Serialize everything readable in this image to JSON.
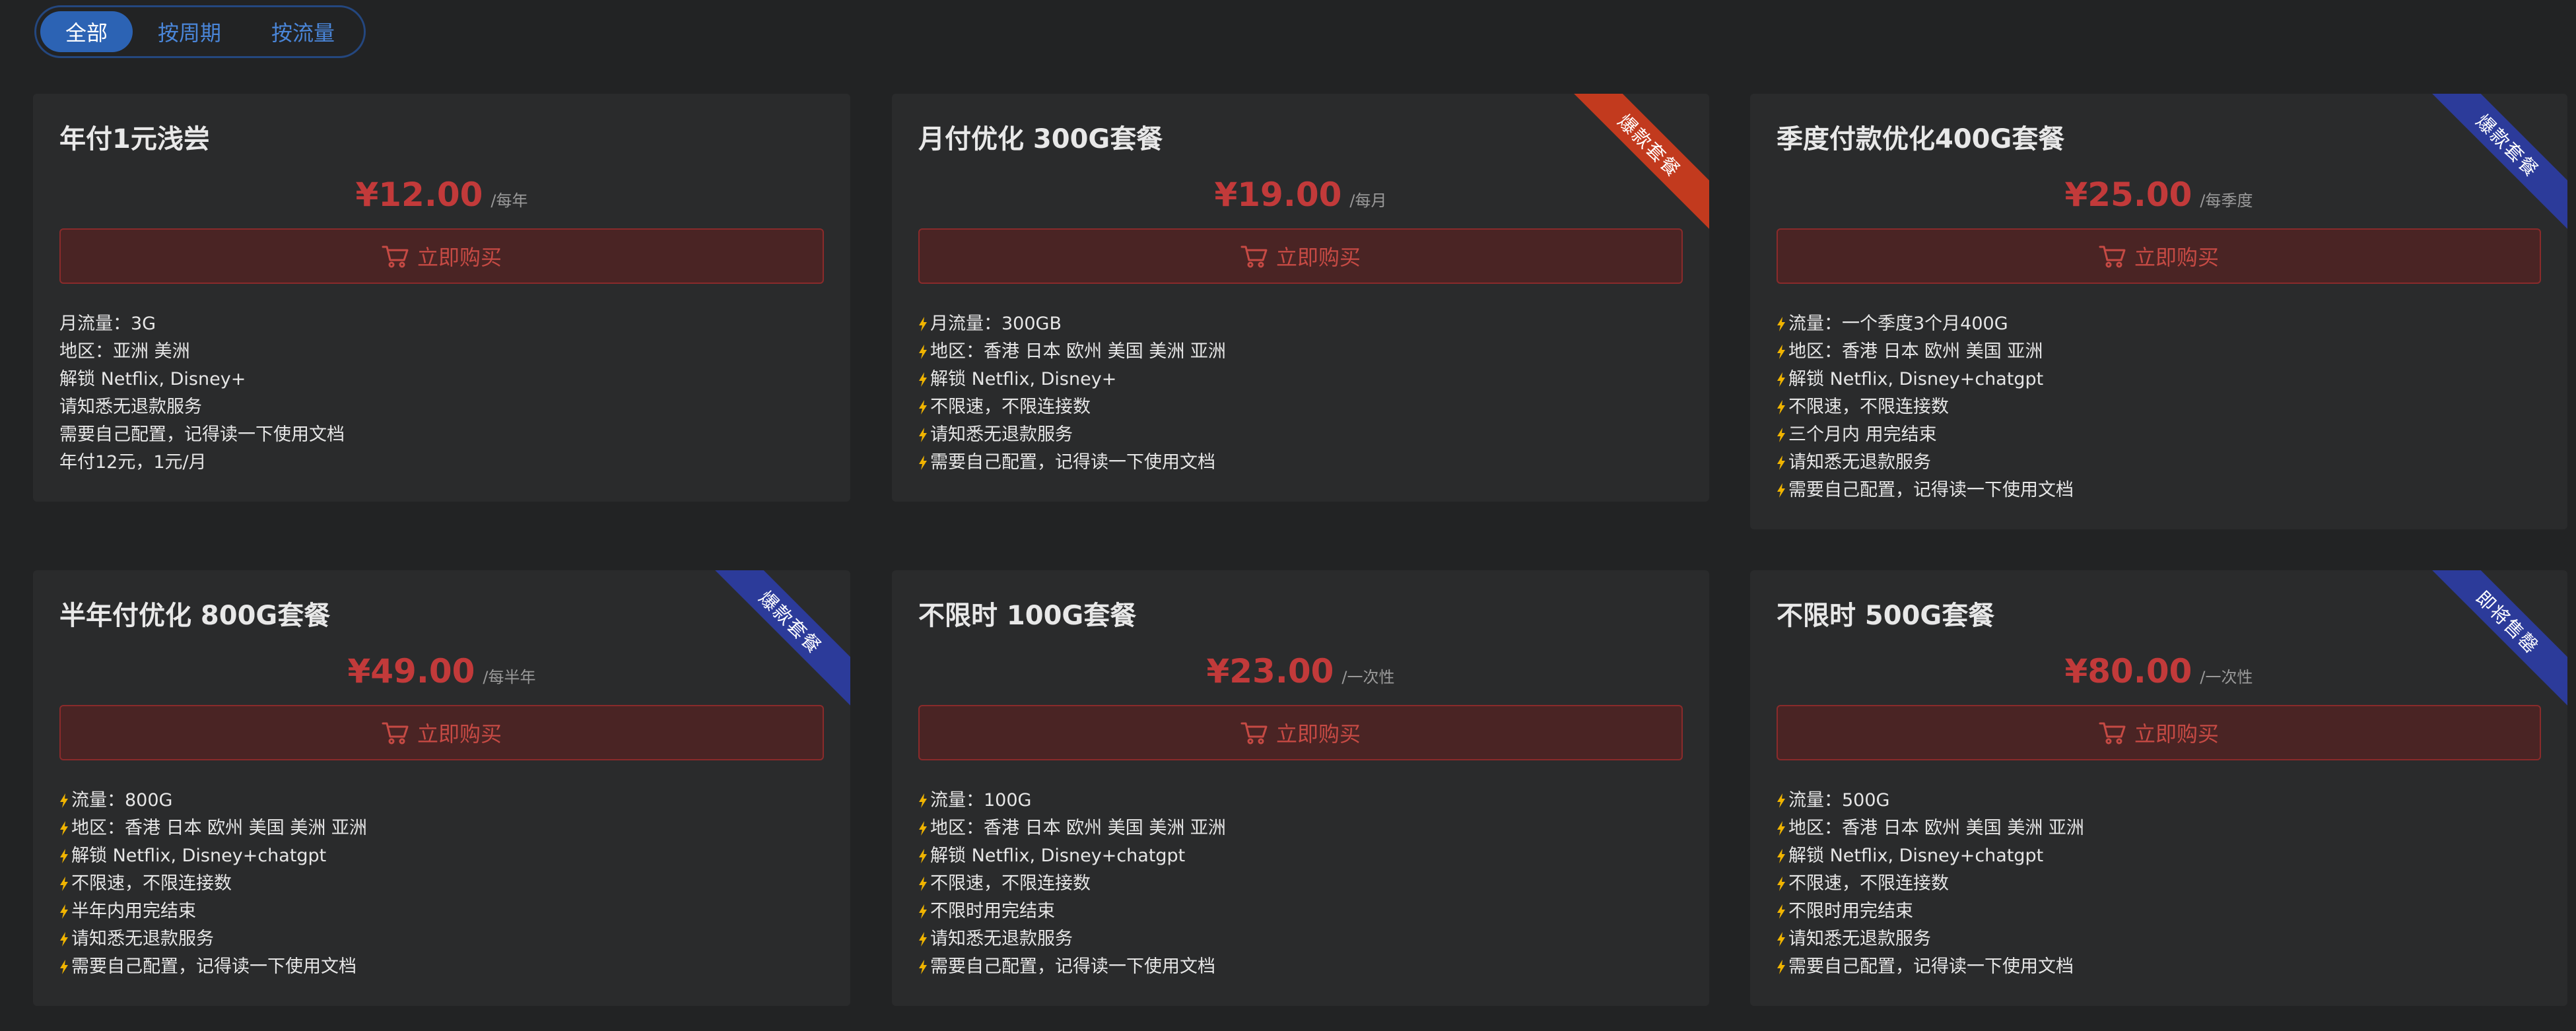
{
  "tabs": [
    {
      "label": "全部",
      "active": true
    },
    {
      "label": "按周期",
      "active": false
    },
    {
      "label": "按流量",
      "active": false
    }
  ],
  "buy_label": "立即购买",
  "colors": {
    "page_bg": "#222324",
    "card_bg": "#2a2b2c",
    "price": "#c23a3a",
    "tab_active": "#2c63b4",
    "ribbon_red": "#c23a1e",
    "ribbon_blue": "#2c3b9a",
    "bolt": "#f0b400"
  },
  "plans": [
    {
      "title": "年付1元浅尝",
      "price": "¥12.00",
      "period": "/每年",
      "ribbon": null,
      "bolts": false,
      "features": [
        "月流量：3G",
        "地区：亚洲 美洲",
        "解锁 Netflix, Disney+",
        "请知悉无退款服务",
        "需要自己配置，记得读一下使用文档",
        "年付12元，1元/月"
      ]
    },
    {
      "title": "月付优化 300G套餐",
      "price": "¥19.00",
      "period": "/每月",
      "ribbon": {
        "text": "爆款套餐",
        "color": "red"
      },
      "bolts": true,
      "features": [
        "月流量：300GB",
        "地区：香港 日本 欧州 美国 美洲 亚洲",
        "解锁 Netflix, Disney+",
        "不限速，不限连接数",
        "请知悉无退款服务",
        "需要自己配置，记得读一下使用文档"
      ]
    },
    {
      "title": "季度付款优化400G套餐",
      "price": "¥25.00",
      "period": "/每季度",
      "ribbon": {
        "text": "爆款套餐",
        "color": "blue"
      },
      "bolts": true,
      "features": [
        "流量：一个季度3个月400G",
        "地区：香港 日本 欧州 美国 亚洲",
        "解锁 Netflix, Disney+chatgpt",
        "不限速，不限连接数",
        "三个月内 用完结束",
        "请知悉无退款服务",
        "需要自己配置，记得读一下使用文档"
      ]
    },
    {
      "title": "半年付优化 800G套餐",
      "price": "¥49.00",
      "period": "/每半年",
      "ribbon": {
        "text": "爆款套餐",
        "color": "blue"
      },
      "bolts": true,
      "features": [
        "流量：800G",
        "地区：香港 日本 欧州 美国 美洲 亚洲",
        "解锁 Netflix, Disney+chatgpt",
        "不限速，不限连接数",
        "半年内用完结束",
        "请知悉无退款服务",
        "需要自己配置，记得读一下使用文档"
      ]
    },
    {
      "title": "不限时 100G套餐",
      "price": "¥23.00",
      "period": "/一次性",
      "ribbon": null,
      "bolts": true,
      "features": [
        "流量：100G",
        "地区：香港 日本 欧州 美国 美洲 亚洲",
        "解锁 Netflix, Disney+chatgpt",
        "不限速，不限连接数",
        "不限时用完结束",
        "请知悉无退款服务",
        "需要自己配置，记得读一下使用文档"
      ]
    },
    {
      "title": "不限时 500G套餐",
      "price": "¥80.00",
      "period": "/一次性",
      "ribbon": {
        "text": "即将售罄",
        "color": "blue"
      },
      "bolts": true,
      "features": [
        "流量：500G",
        "地区：香港 日本 欧州 美国 美洲 亚洲",
        "解锁 Netflix, Disney+chatgpt",
        "不限速，不限连接数",
        "不限时用完结束",
        "请知悉无退款服务",
        "需要自己配置，记得读一下使用文档"
      ]
    }
  ]
}
